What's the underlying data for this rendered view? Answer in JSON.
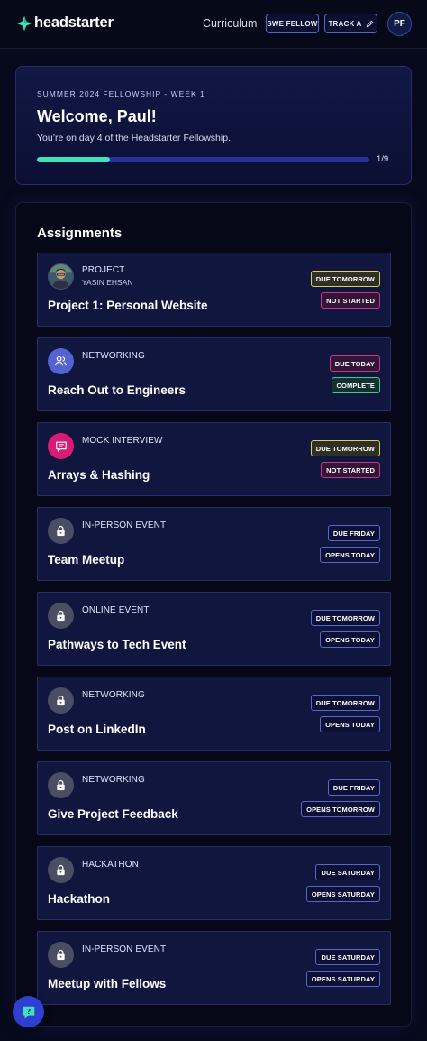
{
  "header": {
    "logo_text": "headstarter",
    "nav_link": "Curriculum",
    "swe_button": "SWE FELLOW",
    "track_button": "TRACK A",
    "avatar_initials": "PF"
  },
  "welcome": {
    "eyebrow": "SUMMER 2024 FELLOWSHIP - WEEK 1",
    "title": "Welcome, Paul!",
    "subtitle": "You’re on day 4 of the Headstarter Fellowship.",
    "progress_label": "1/9",
    "progress_fraction": 0.22
  },
  "assignments": {
    "heading": "Assignments",
    "items": [
      {
        "type": "PROJECT",
        "subtitle": "YASIN EHSAN",
        "title": "Project 1: Personal Website",
        "icon": "avatar-photo",
        "badges": [
          {
            "label": "DUE TOMORROW",
            "color": "yellow"
          },
          {
            "label": "NOT STARTED",
            "color": "pink"
          }
        ]
      },
      {
        "type": "NETWORKING",
        "title": "Reach Out to Engineers",
        "icon": "people-icon",
        "badges": [
          {
            "label": "DUE TODAY",
            "color": "pink"
          },
          {
            "label": "COMPLETE",
            "color": "green"
          }
        ]
      },
      {
        "type": "MOCK INTERVIEW",
        "title": "Arrays & Hashing",
        "icon": "chat-icon",
        "badges": [
          {
            "label": "DUE TOMORROW",
            "color": "yellow"
          },
          {
            "label": "NOT STARTED",
            "color": "pink"
          }
        ]
      },
      {
        "type": "IN-PERSON EVENT",
        "title": "Team Meetup",
        "icon": "lock-icon",
        "badges": [
          {
            "label": "DUE FRIDAY",
            "color": "blue"
          },
          {
            "label": "OPENS TODAY",
            "color": "blue"
          }
        ]
      },
      {
        "type": "ONLINE EVENT",
        "title": "Pathways to Tech Event",
        "icon": "lock-icon",
        "badges": [
          {
            "label": "DUE TOMORROW",
            "color": "blue"
          },
          {
            "label": "OPENS TODAY",
            "color": "blue"
          }
        ]
      },
      {
        "type": "NETWORKING",
        "title": "Post on LinkedIn",
        "icon": "lock-icon",
        "badges": [
          {
            "label": "DUE TOMORROW",
            "color": "blue"
          },
          {
            "label": "OPENS TODAY",
            "color": "blue"
          }
        ]
      },
      {
        "type": "NETWORKING",
        "title": "Give Project Feedback",
        "icon": "lock-icon",
        "badges": [
          {
            "label": "DUE FRIDAY",
            "color": "blue"
          },
          {
            "label": "OPENS TOMORROW",
            "color": "blue"
          }
        ]
      },
      {
        "type": "HACKATHON",
        "title": "Hackathon",
        "icon": "lock-icon",
        "badges": [
          {
            "label": "DUE SATURDAY",
            "color": "blue"
          },
          {
            "label": "OPENS SATURDAY",
            "color": "blue"
          }
        ]
      },
      {
        "type": "IN-PERSON EVENT",
        "title": "Meetup with Fellows",
        "icon": "lock-icon",
        "badges": [
          {
            "label": "DUE SATURDAY",
            "color": "blue"
          },
          {
            "label": "OPENS SATURDAY",
            "color": "blue"
          }
        ]
      }
    ]
  },
  "colors": {
    "accent_teal": "#3fe2bd",
    "primary_blue": "#2e3fd1",
    "badge_yellow": "#d8cf5c",
    "badge_pink": "#c73684",
    "badge_green": "#49c889"
  }
}
